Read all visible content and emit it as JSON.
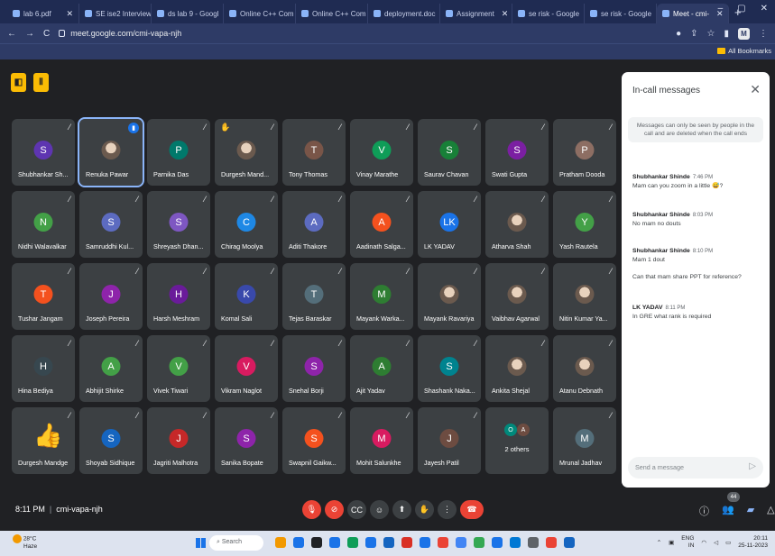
{
  "browser": {
    "tabs": [
      {
        "title": "lab 6.pdf",
        "active": false
      },
      {
        "title": "SE ise2 Interview",
        "active": false
      },
      {
        "title": "ds lab 9 - Googl",
        "active": false
      },
      {
        "title": "Online C++ Com",
        "active": false
      },
      {
        "title": "Online C++ Com",
        "active": false
      },
      {
        "title": "deployment.doc",
        "active": false
      },
      {
        "title": "Assignment",
        "active": false
      },
      {
        "title": "se risk - Google",
        "active": false
      },
      {
        "title": "se risk - Google",
        "active": false
      },
      {
        "title": "Meet - cmi-",
        "active": true
      }
    ],
    "new_tab": "+",
    "url": "meet.google.com/cmi-vapa-njh",
    "profile_initial": "M",
    "bookmarks_label": "All Bookmarks"
  },
  "meeting": {
    "time": "8:11 PM",
    "code": "cmi-vapa-njh",
    "participant_count": "44"
  },
  "participants": [
    {
      "name": "Shubhankar Sh...",
      "initial": "S",
      "color": "#5e35b1",
      "type": "letter"
    },
    {
      "name": "Renuka Pawar",
      "initial": "",
      "color": "#4a3a36",
      "type": "photo",
      "speaking": true
    },
    {
      "name": "Parnika Das",
      "initial": "P",
      "color": "#00796b",
      "type": "letter"
    },
    {
      "name": "Durgesh Mand...",
      "initial": "",
      "color": "#ffffff",
      "type": "photo",
      "hand": true
    },
    {
      "name": "Tony Thomas",
      "initial": "T",
      "color": "#795548",
      "type": "letter"
    },
    {
      "name": "Vinay Marathe",
      "initial": "V",
      "color": "#0f9d58",
      "type": "letter"
    },
    {
      "name": "Saurav Chavan",
      "initial": "S",
      "color": "#188038",
      "type": "letter"
    },
    {
      "name": "Swati Gupta",
      "initial": "S",
      "color": "#7b1fa2",
      "type": "letter"
    },
    {
      "name": "Pratham Dooda",
      "initial": "P",
      "color": "#8d6e63",
      "type": "letter"
    },
    {
      "name": "Nidhi Walavalkar",
      "initial": "N",
      "color": "#43a047",
      "type": "letter"
    },
    {
      "name": "Samruddhi Kul...",
      "initial": "S",
      "color": "#5c6bc0",
      "type": "letter"
    },
    {
      "name": "Shreyash Dhan...",
      "initial": "S",
      "color": "#7e57c2",
      "type": "letter"
    },
    {
      "name": "Chirag Moolya",
      "initial": "C",
      "color": "#1e88e5",
      "type": "letter"
    },
    {
      "name": "Aditi Thakore",
      "initial": "A",
      "color": "#5c6bc0",
      "type": "letter"
    },
    {
      "name": "Aadinath Salga...",
      "initial": "A",
      "color": "#f4511e",
      "type": "letter"
    },
    {
      "name": "LK YADAV",
      "initial": "LK",
      "color": "#1a73e8",
      "type": "letter"
    },
    {
      "name": "Atharva Shah",
      "initial": "",
      "color": "#3c3c3c",
      "type": "photo"
    },
    {
      "name": "Yash Rautela",
      "initial": "Y",
      "color": "#43a047",
      "type": "letter"
    },
    {
      "name": "Tushar Jangam",
      "initial": "T",
      "color": "#f4511e",
      "type": "letter"
    },
    {
      "name": "Joseph Pereira",
      "initial": "J",
      "color": "#8e24aa",
      "type": "letter"
    },
    {
      "name": "Harsh Meshram",
      "initial": "H",
      "color": "#6a1b9a",
      "type": "letter"
    },
    {
      "name": "Komal Sali",
      "initial": "K",
      "color": "#3949ab",
      "type": "letter"
    },
    {
      "name": "Tejas Baraskar",
      "initial": "T",
      "color": "#546e7a",
      "type": "letter"
    },
    {
      "name": "Mayank Warka...",
      "initial": "M",
      "color": "#2e7d32",
      "type": "letter"
    },
    {
      "name": "Mayank Ravariya",
      "initial": "",
      "color": "#4db6ac",
      "type": "photo"
    },
    {
      "name": "Vaibhav Agarwal",
      "initial": "",
      "color": "#cfd8dc",
      "type": "photo"
    },
    {
      "name": "Nitin Kumar Ya...",
      "initial": "",
      "color": "#3949ab",
      "type": "photo"
    },
    {
      "name": "Hina Bediya",
      "initial": "H",
      "color": "#37474f",
      "type": "letter"
    },
    {
      "name": "Abhijit Shirke",
      "initial": "A",
      "color": "#43a047",
      "type": "letter"
    },
    {
      "name": "Vivek Tiwari",
      "initial": "V",
      "color": "#43a047",
      "type": "letter"
    },
    {
      "name": "Vikram Naglot",
      "initial": "V",
      "color": "#d81b60",
      "type": "letter"
    },
    {
      "name": "Snehal Borji",
      "initial": "S",
      "color": "#8e24aa",
      "type": "letter"
    },
    {
      "name": "Ajit Yadav",
      "initial": "A",
      "color": "#2e7d32",
      "type": "letter"
    },
    {
      "name": "Shashank Naka...",
      "initial": "S",
      "color": "#00838f",
      "type": "letter"
    },
    {
      "name": "Ankita Shejal",
      "initial": "",
      "color": "#455a64",
      "type": "photo"
    },
    {
      "name": "Atanu Debnath",
      "initial": "",
      "color": "#795548",
      "type": "photo"
    },
    {
      "name": "Durgesh Mandge",
      "initial": "",
      "color": "#ff9800",
      "type": "thumb"
    },
    {
      "name": "Shoyab Sidhique",
      "initial": "S",
      "color": "#1565c0",
      "type": "letter"
    },
    {
      "name": "Jagriti Malhotra",
      "initial": "J",
      "color": "#c62828",
      "type": "letter"
    },
    {
      "name": "Sanika Bopate",
      "initial": "S",
      "color": "#8e24aa",
      "type": "letter"
    },
    {
      "name": "Swapnil Gaikw...",
      "initial": "S",
      "color": "#f4511e",
      "type": "letter"
    },
    {
      "name": "Mohit Salunkhe",
      "initial": "M",
      "color": "#d81b60",
      "type": "letter"
    },
    {
      "name": "Jayesh Patil",
      "initial": "J",
      "color": "#6d4c41",
      "type": "letter"
    },
    {
      "name": "2 others",
      "initial": "",
      "color": "#3c4043",
      "type": "others"
    },
    {
      "name": "Mrunal Jadhav",
      "initial": "M",
      "color": "#546e7a",
      "type": "letter"
    }
  ],
  "others_initials": [
    {
      "letter": "O",
      "color": "#00897b"
    },
    {
      "letter": "A",
      "color": "#6d4c41"
    }
  ],
  "chat": {
    "title": "In-call messages",
    "note": "Messages can only be seen by people in the call and are deleted when the call ends",
    "messages": [
      {
        "sender": "Shubhankar Shinde",
        "time": "7:46 PM",
        "lines": [
          "Mam can you zoom in a little 😅?"
        ]
      },
      {
        "sender": "Shubhankar Shinde",
        "time": "8:03 PM",
        "lines": [
          "No mam no douts"
        ]
      },
      {
        "sender": "Shubhankar Shinde",
        "time": "8:10 PM",
        "lines": [
          "Mam 1 dout",
          "Can that mam share PPT for reference?"
        ]
      },
      {
        "sender": "LK YADAV",
        "time": "8:11 PM",
        "lines": [
          "In GRE what rank is required"
        ]
      }
    ],
    "input_placeholder": "Send a message"
  },
  "taskbar": {
    "weather_temp": "28°C",
    "weather_desc": "Haze",
    "search_placeholder": "Search",
    "lang": "ENG",
    "lang_region": "IN",
    "clock_time": "20:11",
    "clock_date": "25-11-2023"
  }
}
